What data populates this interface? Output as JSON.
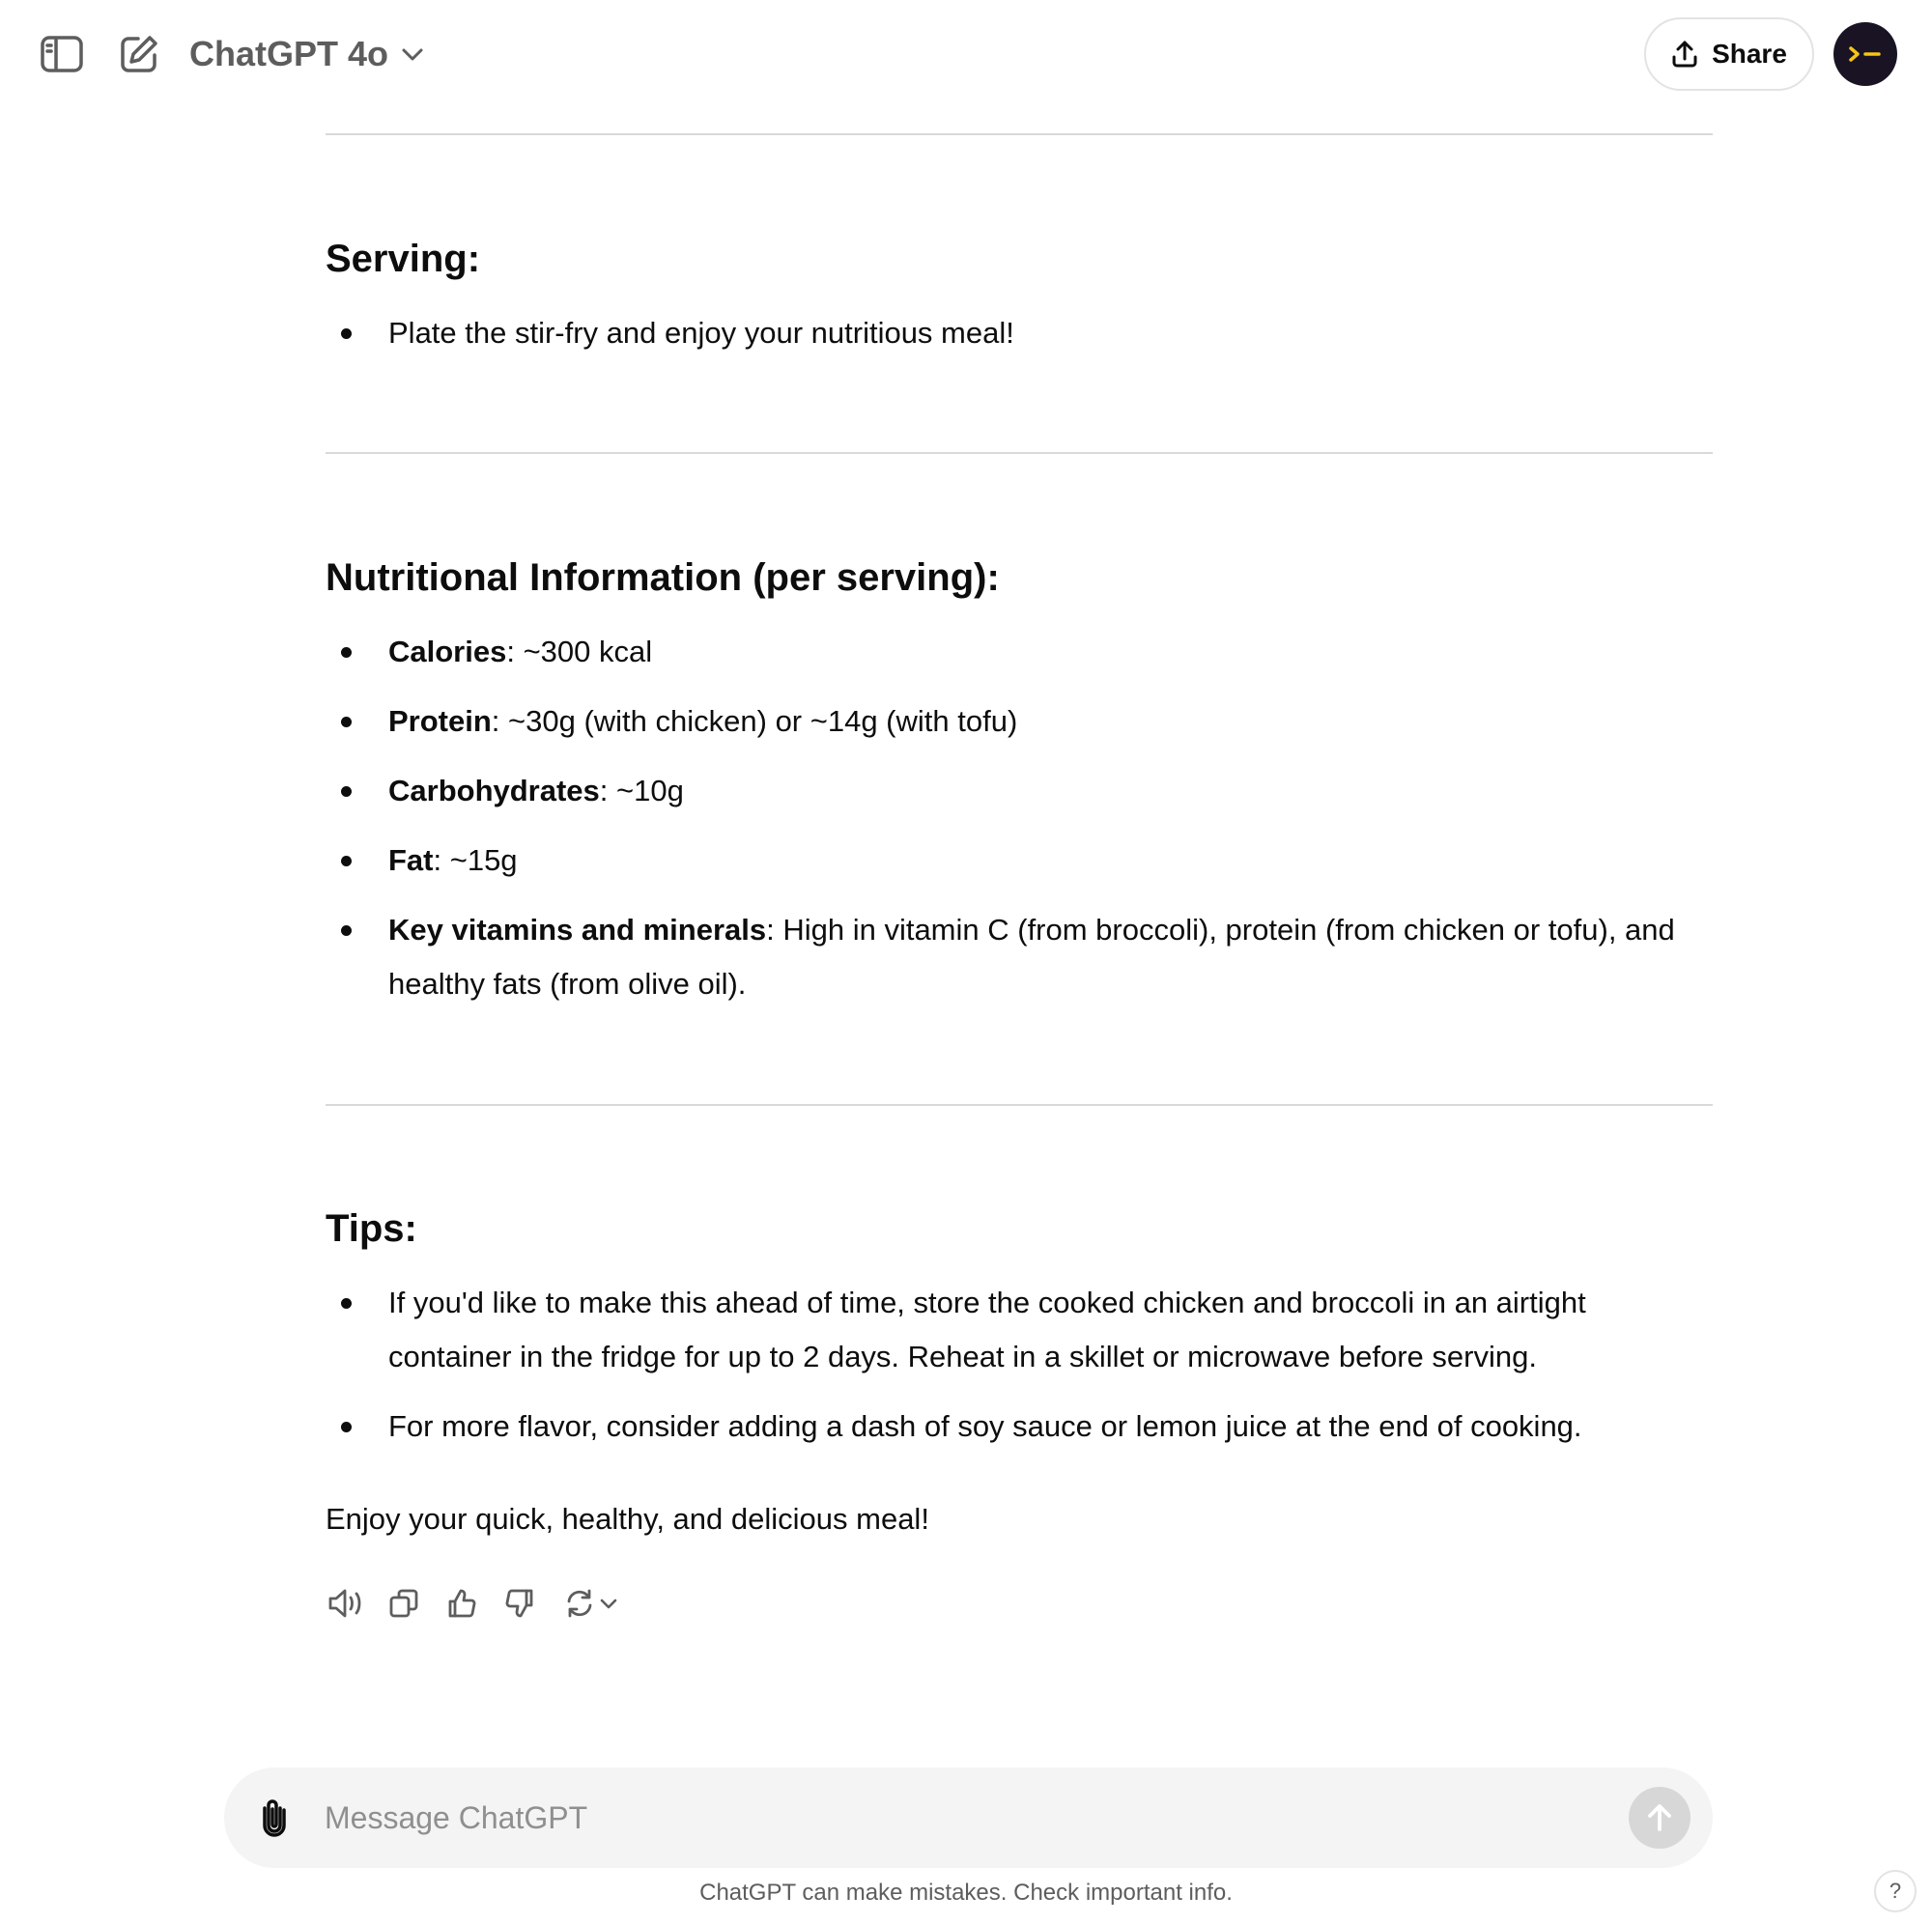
{
  "header": {
    "model_name": "ChatGPT 4o",
    "share_label": "Share",
    "avatar_glyph": ">_"
  },
  "sections": {
    "serving": {
      "heading": "Serving:",
      "items": [
        "Plate the stir-fry and enjoy your nutritious meal!"
      ]
    },
    "nutrition": {
      "heading": "Nutritional Information (per serving):",
      "items": [
        {
          "label": "Calories",
          "text": ": ~300 kcal"
        },
        {
          "label": "Protein",
          "text": ": ~30g (with chicken) or ~14g (with tofu)"
        },
        {
          "label": "Carbohydrates",
          "text": ": ~10g"
        },
        {
          "label": "Fat",
          "text": ": ~15g"
        },
        {
          "label": "Key vitamins and minerals",
          "text": ": High in vitamin C (from broccoli), protein (from chicken or tofu), and healthy fats (from olive oil)."
        }
      ]
    },
    "tips": {
      "heading": "Tips:",
      "items": [
        "If you'd like to make this ahead of time, store the cooked chicken and broccoli in an airtight container in the fridge for up to 2 days. Reheat in a skillet or microwave before serving.",
        "For more flavor, consider adding a dash of soy sauce or lemon juice at the end of cooking."
      ]
    },
    "closing": "Enjoy your quick, healthy, and delicious meal!"
  },
  "actions": [
    "read-aloud-icon",
    "copy-icon",
    "thumbs-up-icon",
    "thumbs-down-icon",
    "regenerate-icon"
  ],
  "composer": {
    "placeholder": "Message ChatGPT"
  },
  "footer": {
    "disclaimer": "ChatGPT can make mistakes. Check important info.",
    "help_label": "?"
  },
  "colors": {
    "avatar_bg": "#1a1323",
    "avatar_fg": "#f5c518",
    "composer_bg": "#f4f4f4",
    "send_disabled": "#d7d7d7"
  }
}
